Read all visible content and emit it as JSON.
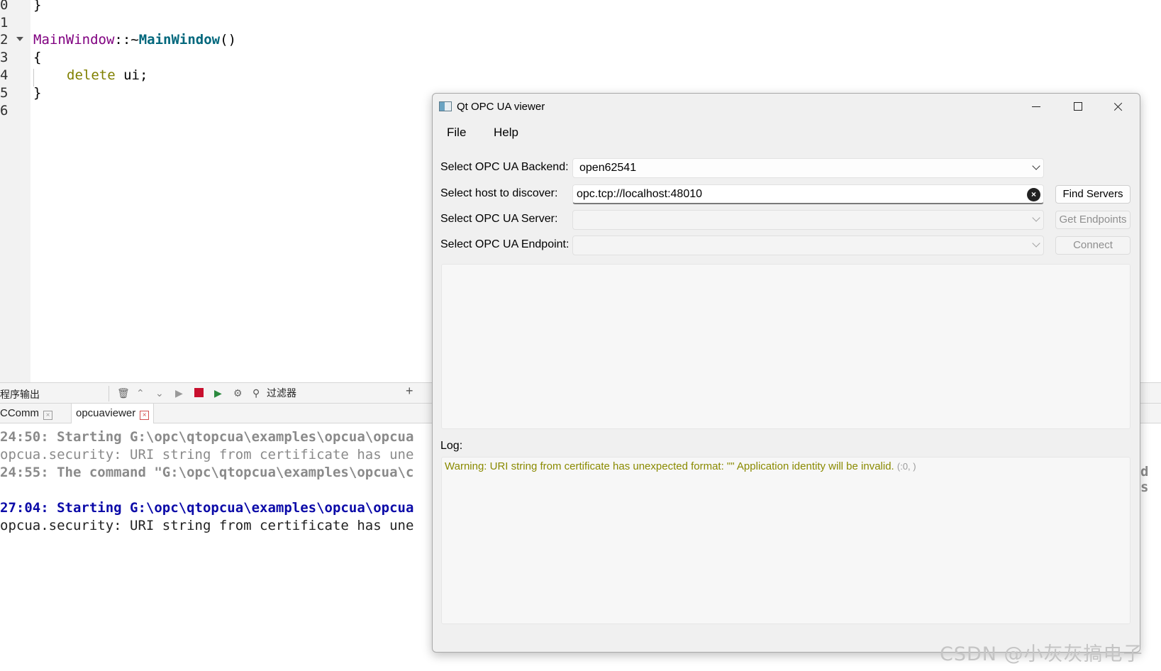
{
  "editor": {
    "lines": [
      {
        "num": "0"
      },
      {
        "num": "1"
      },
      {
        "num": "2"
      },
      {
        "num": "3"
      },
      {
        "num": "4"
      },
      {
        "num": "5"
      },
      {
        "num": "6"
      }
    ],
    "code": {
      "close_brace_0": "}",
      "class_name": "MainWindow",
      "scope_op": "::",
      "tilde": "~",
      "func_name": "MainWindow",
      "parens": "()",
      "open_brace": "{",
      "delete_kw": "delete",
      "delete_target": " ui;",
      "close_brace_5": "}"
    }
  },
  "output_pane": {
    "title": "程序输出",
    "filter_label": "过滤器",
    "add_icon": "+",
    "tabs": [
      {
        "label": "CComm"
      },
      {
        "label": "opcuaviewer"
      }
    ],
    "lines": [
      "24:50: Starting G:\\opc\\qtopcua\\examples\\opcua\\opcua",
      "opcua.security: URI string from certificate has une",
      "24:55: The command \"G:\\opc\\qtopcua\\examples\\opcua\\c",
      "27:04: Starting G:\\opc\\qtopcua\\examples\\opcua\\opcua",
      "opcua.security: URI string from certificate has une"
    ],
    "peek_text": "d s"
  },
  "viewer": {
    "title": "Qt OPC UA viewer",
    "menu": {
      "file": "File",
      "help": "Help"
    },
    "backend": {
      "label": "Select OPC UA Backend:",
      "value": "open62541"
    },
    "host": {
      "label": "Select host to discover:",
      "value": "opc.tcp://localhost:48010"
    },
    "server": {
      "label": "Select OPC UA Server:",
      "value": ""
    },
    "endpoint": {
      "label": "Select OPC UA Endpoint:",
      "value": ""
    },
    "buttons": {
      "find_servers": "Find Servers",
      "get_endpoints": "Get Endpoints",
      "connect": "Connect"
    },
    "log": {
      "label": "Log:",
      "message": "Warning: URI string from certificate has unexpected format: \"\" Application identity will be invalid.",
      "context": "(:0, )"
    }
  },
  "watermark": "CSDN @小灰灰搞电子",
  "colors": {
    "keyword": "#808000",
    "class": "#800080",
    "function": "#00677c",
    "output_blue": "#0b0aa8",
    "log_warning": "#8a8a00"
  }
}
